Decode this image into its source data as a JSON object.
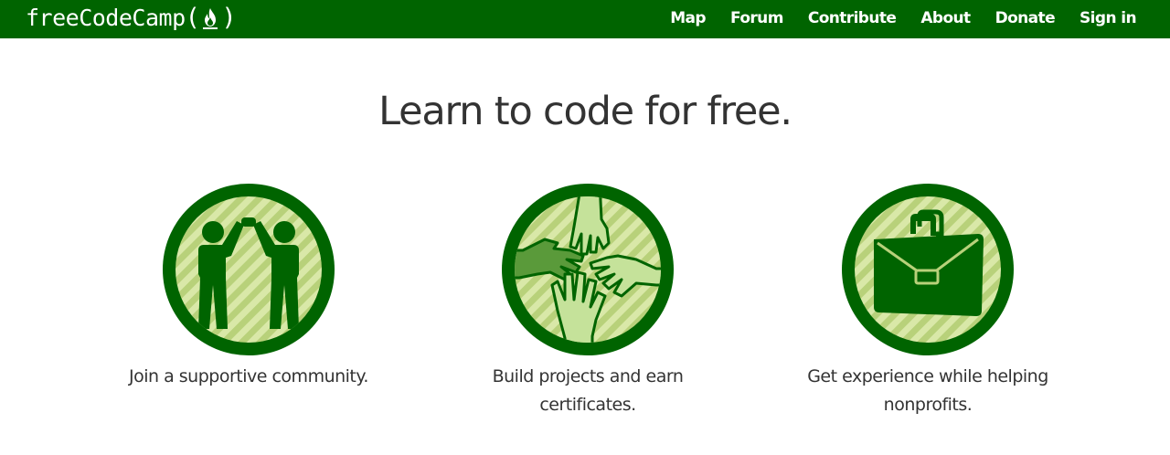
{
  "nav": {
    "brand": "freeCodeCamp",
    "links": [
      "Map",
      "Forum",
      "Contribute",
      "About",
      "Donate",
      "Sign in"
    ]
  },
  "hero": {
    "headline": "Learn to code for free."
  },
  "features": [
    {
      "icon": "high-five-icon",
      "line1": "Join a supportive community.",
      "line2": ""
    },
    {
      "icon": "hands-icon",
      "line1": "Build projects and earn",
      "line2": "certificates."
    },
    {
      "icon": "briefcase-icon",
      "line1": "Get experience while helping",
      "line2": "nonprofits."
    }
  ],
  "colors": {
    "brand_green": "#006400",
    "stripe_light": "#d9e8a8",
    "stripe_dark": "#b8d17a",
    "hand_light": "#c5e29a",
    "hand_mid": "#a4c76a",
    "text": "#333333"
  }
}
